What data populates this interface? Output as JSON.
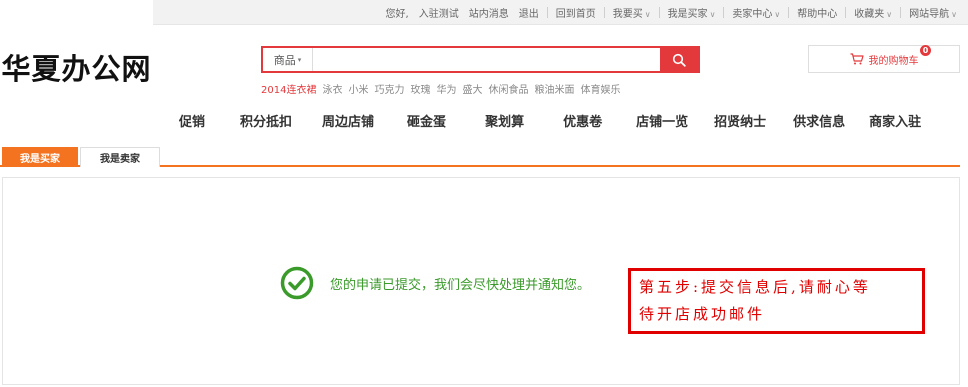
{
  "logo": {
    "text": "华夏办公网"
  },
  "top_nav": {
    "greeting": "您好,",
    "items": [
      "入驻测试",
      "站内消息",
      "退出",
      "回到首页",
      "我要买",
      "我是买家",
      "卖家中心",
      "帮助中心",
      "收藏夹",
      "网站导航"
    ]
  },
  "search": {
    "category": "商品",
    "value": "",
    "placeholder": "",
    "hot_words": [
      "2014连衣裙",
      "泳衣",
      "小米",
      "巧克力",
      "玫瑰",
      "华为",
      "盛大",
      "休闲食品",
      "粮油米面",
      "体育娱乐"
    ]
  },
  "cart": {
    "label": "我的购物车",
    "count": "0"
  },
  "main_nav": [
    "促销",
    "积分抵扣",
    "周边店铺",
    "砸金蛋",
    "聚划算",
    "优惠卷",
    "店铺一览",
    "招贤纳士",
    "供求信息",
    "商家入驻"
  ],
  "tabs": {
    "buyer": "我是买家",
    "seller": "我是卖家"
  },
  "status": {
    "message": "您的申请已提交，我们会尽快处理并通知您。"
  },
  "annotation": {
    "line1": "第五步:提交信息后,请耐心等",
    "line2": "待开店成功邮件"
  },
  "colors": {
    "accent": "#e4393c",
    "tab_active": "#f37321",
    "success": "#3a9a2a",
    "annotation": "#e00000"
  }
}
